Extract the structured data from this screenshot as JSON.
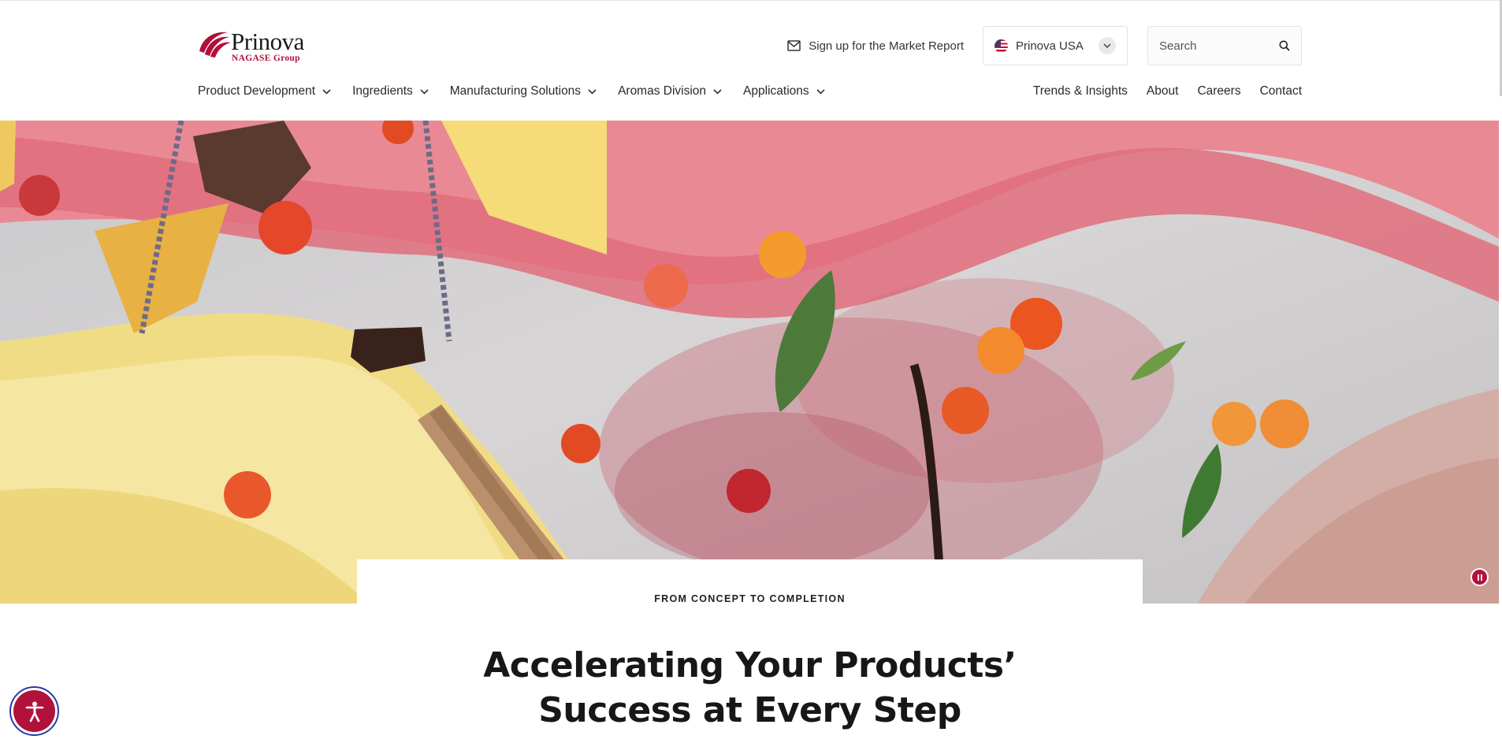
{
  "brand": {
    "name": "Prinova",
    "tagline": "NAGASE Group",
    "color": "#b0103a"
  },
  "utility": {
    "market_report_label": "Sign up for the Market Report",
    "country_label": "Prinova USA",
    "search_placeholder": "Search"
  },
  "nav": {
    "main": [
      {
        "label": "Product Development"
      },
      {
        "label": "Ingredients"
      },
      {
        "label": "Manufacturing Solutions"
      },
      {
        "label": "Aromas Division"
      },
      {
        "label": "Applications"
      }
    ],
    "secondary": [
      {
        "label": "Trends & Insights"
      },
      {
        "label": "About"
      },
      {
        "label": "Careers"
      },
      {
        "label": "Contact"
      }
    ]
  },
  "hero": {
    "eyebrow": "FROM CONCEPT TO COMPLETION",
    "headline_line1": "Accelerating Your Products’",
    "headline_line2": "Success at Every Step"
  },
  "icons": {
    "market": "envelope-icon",
    "country": "us-flag-icon",
    "dropdown": "chevron-down-icon",
    "search": "search-icon",
    "pause": "pause-icon",
    "accessibility": "accessibility-icon"
  }
}
